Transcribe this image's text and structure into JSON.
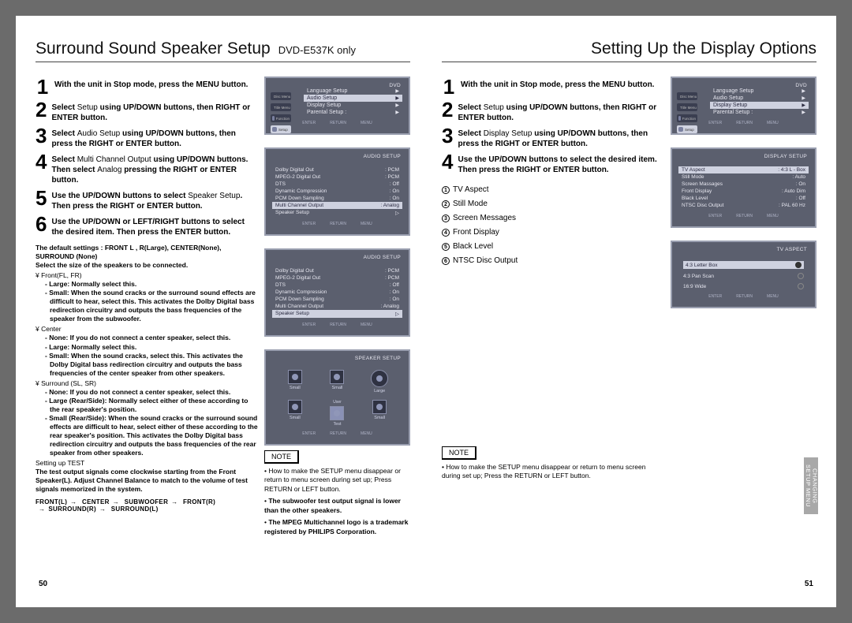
{
  "left": {
    "title": "Surround Sound Speaker Setup",
    "subtitle": "DVD-E537K only",
    "steps": [
      {
        "n": "1",
        "pre": "With the unit in Stop mode, press the ",
        "b": "MENU button.",
        "post": ""
      },
      {
        "n": "2",
        "pre": "Select ",
        "mid": "Setup",
        "post": " using UP/DOWN buttons, then RIGHT or ENTER button."
      },
      {
        "n": "3",
        "pre": "Select ",
        "mid": "Audio Setup",
        "post": " using UP/DOWN buttons, then press the RIGHT or ENTER button."
      },
      {
        "n": "4",
        "pre": "Select ",
        "mid": "Multi Channel Output",
        "post": " using UP/DOWN buttons. Then select ",
        "mid2": "Analog",
        "post2": " pressing the RIGHT or ENTER button."
      },
      {
        "n": "5",
        "pre": "Use the UP/DOWN buttons to select ",
        "mid": "Speaker Setup",
        "post": ". Then press the RIGHT or ENTER button."
      },
      {
        "n": "6",
        "pre": "Use the UP/DOWN or LEFT/RIGHT buttons to select the desired item. Then press the ENTER button.",
        "mid": "",
        "post": ""
      }
    ],
    "defaults": "The default settings : FRONT L , R(Large), CENTER(None), SURROUND (None)",
    "selectSize": "Select the size of the speakers to be connected.",
    "front_label": "¥ Front(FL, FR)",
    "front_large": "- Large: Normally select this.",
    "front_small": "- Small: When the sound cracks or the surround sound effects are difficult to hear, select this. This activates the Dolby Digital bass redirection circuitry and outputs the bass frequencies of the speaker from the subwoofer.",
    "center_label": "¥ Center",
    "center_none": "- None: If you do not connect a center speaker, select this.",
    "center_large": "- Large: Normally select this.",
    "center_small": "- Small: When the sound cracks, select this. This activates the Dolby Digital bass redirection circuitry and outputs the bass frequencies of the center speaker from other speakers.",
    "surround_label": "¥ Surround (SL, SR)",
    "surround_none": "- None: If you do not connect a center speaker, select this.",
    "surround_large": "- Large (Rear/Side): Normally select either of these according to the rear speaker's position.",
    "surround_small": "- Small (Rear/Side): When the sound cracks or the surround sound effects are difficult to hear, select either of these according to the rear speaker's position. This activates the Dolby Digital bass redirection circuitry and outputs the bass frequencies of the rear speaker from other speakers.",
    "test_hdr": "Setting up TEST",
    "test_txt": "The test output signals come clockwise starting from the Front Speaker(L). Adjust Channel Balance to match to the volume of test signals memorized in the system.",
    "flow": [
      "FRONT(L)",
      "CENTER",
      "SUBWOOFER",
      "FRONT(R)",
      "SURROUND(R)",
      "SURROUND(L)"
    ],
    "note_label": "NOTE",
    "notes": [
      "How to make the SETUP menu disappear or return to menu screen during set up; Press RETURN or LEFT button.",
      "The subwoofer test output signal is lower than the other speakers.",
      "The MPEG Multichannel logo is a trademark registered by PHILIPS Corporation."
    ],
    "page": "50",
    "osd1": {
      "title": "DVD",
      "items": [
        "Language Setup",
        "Audio Setup",
        "Display Setup",
        "Parental Setup :"
      ],
      "selIndex": 1,
      "side": [
        "Disc Menu",
        "Title Menu",
        "Function",
        "Setup"
      ],
      "btns": [
        "ENTER",
        "RETURN",
        "MENU"
      ]
    },
    "osd2": {
      "title": "AUDIO SETUP",
      "rows": [
        {
          "l": "Dolby Digital Out",
          "v": ": PCM"
        },
        {
          "l": "MPEG-2 Digital Out",
          "v": ": PCM"
        },
        {
          "l": "DTS",
          "v": ": Off"
        },
        {
          "l": "Dynamic Compression",
          "v": ": On"
        },
        {
          "l": "PCM Down Sampling",
          "v": ": On"
        },
        {
          "l": "Multi Channel Output",
          "v": ": Analog"
        },
        {
          "l": "Speaker Setup",
          "v": "▷"
        }
      ],
      "selIndex": 5,
      "btns": [
        "ENTER",
        "RETURN",
        "MENU"
      ]
    },
    "osd3": {
      "title": "AUDIO SETUP",
      "rows": [
        {
          "l": "Dolby Digital Out",
          "v": ": PCM"
        },
        {
          "l": "MPEG-2 Digital Out",
          "v": ": PCM"
        },
        {
          "l": "DTS",
          "v": ": Off"
        },
        {
          "l": "Dynamic Compression",
          "v": ": On"
        },
        {
          "l": "PCM Down Sampling",
          "v": ": On"
        },
        {
          "l": "Multi Channel Output",
          "v": ": Analog"
        },
        {
          "l": "Speaker Setup",
          "v": "▷"
        }
      ],
      "selIndex": 6,
      "btns": [
        "ENTER",
        "RETURN",
        "MENU"
      ]
    },
    "osd4": {
      "title": "SPEAKER SETUP",
      "spk": [
        {
          "top": "",
          "bot": "Small"
        },
        {
          "top": "",
          "bot": "Small"
        },
        {
          "top": "",
          "bot": "Large",
          "circle": true
        },
        {
          "top": "",
          "bot": "Small"
        },
        {
          "top": "User",
          "bot": "Test",
          "person": true
        },
        {
          "top": "",
          "bot": "Small"
        }
      ],
      "btns": [
        "ENTER",
        "RETURN",
        "MENU"
      ]
    }
  },
  "right": {
    "title": "Setting Up the Display Options",
    "steps": [
      {
        "n": "1",
        "pre": "With the unit in Stop mode, press the ",
        "b": "MENU button.",
        "post": ""
      },
      {
        "n": "2",
        "pre": "Select ",
        "mid": "Setup",
        "post": " using UP/DOWN buttons, then RIGHT or ENTER button."
      },
      {
        "n": "3",
        "pre": "Select ",
        "mid": "Display Setup",
        "post": " using UP/DOWN buttons, then press the RIGHT or ENTER button."
      },
      {
        "n": "4",
        "pre": "Use the UP/DOWN buttons to select the desired item. Then press the RIGHT or ENTER button.",
        "mid": "",
        "post": ""
      }
    ],
    "list": [
      "TV Aspect",
      "Still Mode",
      "Screen Messages",
      "Front Display",
      "Black Level",
      "NTSC Disc Output"
    ],
    "note_label": "NOTE",
    "note_txt": "How to make the SETUP menu disappear or return to menu screen during set up; Press the RETURN or LEFT button.",
    "page": "51",
    "side_tab": "CHANGING\nSETUP MENU",
    "osd1": {
      "title": "DVD",
      "items": [
        "Language Setup",
        "Audio Setup",
        "Display Setup",
        "Parental Setup :"
      ],
      "selIndex": 2,
      "side": [
        "Disc Menu",
        "Title Menu",
        "Function",
        "Setup"
      ],
      "btns": [
        "ENTER",
        "RETURN",
        "MENU"
      ]
    },
    "osd2": {
      "title": "DISPLAY SETUP",
      "rows": [
        {
          "l": "TV Aspect",
          "v": ": 4:3  L - Box"
        },
        {
          "l": "Still Mode",
          "v": ": Auto"
        },
        {
          "l": "Screen Massages",
          "v": ": On"
        },
        {
          "l": "Front Display",
          "v": ": Auto Dim"
        },
        {
          "l": "Black Level",
          "v": ": Off"
        },
        {
          "l": "NTSC Disc Output",
          "v": ": PAL 60 Hz"
        }
      ],
      "selIndex": 0,
      "btns": [
        "ENTER",
        "RETURN",
        "MENU"
      ]
    },
    "osd3": {
      "title": "TV ASPECT",
      "opts": [
        "4:3 Letter Box",
        "4:3 Pan Scan",
        "16:9 Wide"
      ],
      "selIndex": 0,
      "btns": [
        "ENTER",
        "RETURN",
        "MENU"
      ]
    }
  }
}
